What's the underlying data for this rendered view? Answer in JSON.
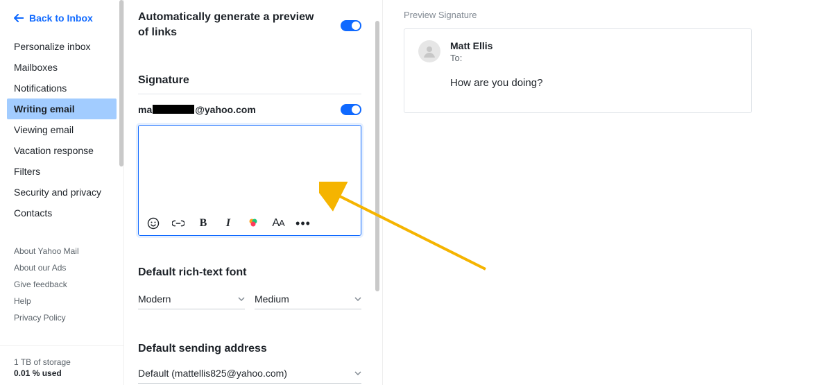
{
  "back_label": "Back to Inbox",
  "nav": [
    "Personalize inbox",
    "Mailboxes",
    "Notifications",
    "Writing email",
    "Viewing email",
    "Vacation response",
    "Filters",
    "Security and privacy",
    "Contacts"
  ],
  "nav_active_index": 3,
  "footer_links": [
    "About Yahoo Mail",
    "About our Ads",
    "Give feedback",
    "Help",
    "Privacy Policy"
  ],
  "storage": {
    "line1": "1 TB of storage",
    "line2": "0.01 % used"
  },
  "settings": {
    "auto_preview_label": "Automatically generate a preview of links",
    "signature_heading": "Signature",
    "email_prefix": "ma",
    "email_suffix": "@yahoo.com",
    "font_heading": "Default rich-text font",
    "font_family": "Modern",
    "font_size": "Medium",
    "addr_heading": "Default sending address",
    "addr_value": "Default (mattellis825@yahoo.com)"
  },
  "preview": {
    "title": "Preview Signature",
    "from": "Matt Ellis",
    "to_label": "To:",
    "body": "How are you doing?"
  }
}
